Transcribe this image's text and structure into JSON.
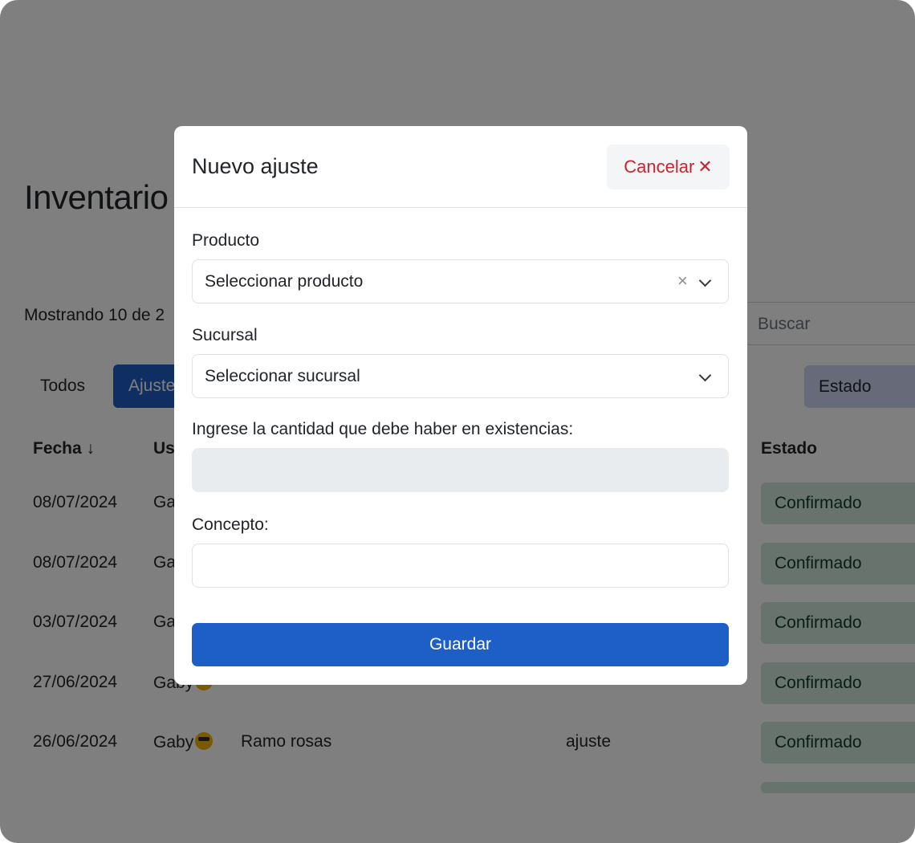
{
  "page": {
    "title": "Inventario",
    "showing_text": "Mostrando 10 de 2",
    "search_placeholder": "Buscar",
    "filters": {
      "todos": "Todos",
      "ajustes": "Ajustes"
    },
    "estado_filter": "Estado",
    "table": {
      "headers": {
        "fecha": "Fecha ↓",
        "usuario": "Us",
        "estado": "Estado"
      },
      "rows": [
        {
          "fecha": "08/07/2024",
          "usuario": "Ga",
          "concepto": "",
          "tipo": "",
          "estado": "Confirmado"
        },
        {
          "fecha": "08/07/2024",
          "usuario": "Ga",
          "concepto": "",
          "tipo": "",
          "estado": "Confirmado"
        },
        {
          "fecha": "03/07/2024",
          "usuario": "Ga",
          "concepto": "",
          "tipo": "",
          "estado": "Confirmado"
        },
        {
          "fecha": "27/06/2024",
          "usuario": "Gaby",
          "concepto": "",
          "tipo": "",
          "estado": "Confirmado"
        },
        {
          "fecha": "26/06/2024",
          "usuario": "Gaby",
          "concepto": "Ramo rosas",
          "tipo": "ajuste",
          "estado": "Confirmado"
        }
      ]
    }
  },
  "modal": {
    "title": "Nuevo ajuste",
    "cancel_label": "Cancelar",
    "cancel_icon": "✕",
    "producto": {
      "label": "Producto",
      "value": "Seleccionar producto",
      "clear_icon": "×"
    },
    "sucursal": {
      "label": "Sucursal",
      "value": "Seleccionar sucursal"
    },
    "cantidad": {
      "label": "Ingrese la cantidad que debe haber en existencias:",
      "value": ""
    },
    "concepto": {
      "label": "Concepto:",
      "value": ""
    },
    "save_label": "Guardar"
  },
  "colors": {
    "primary": "#1e5fc7",
    "danger": "#c9252f",
    "success_bg": "#d1e7dd",
    "backdrop": "rgba(0,0,0,0.5)"
  }
}
